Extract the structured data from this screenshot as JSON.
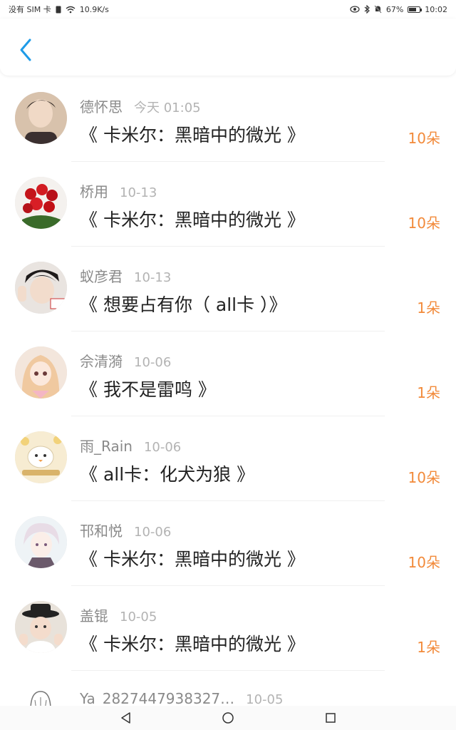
{
  "status": {
    "carrier": "没有 SIM 卡",
    "speed": "10.9K/s",
    "battery_percent": "67%",
    "time": "10:02"
  },
  "header": {
    "back_icon": "chevron-left-icon",
    "accent": "#1e9be8"
  },
  "items": [
    {
      "name": "德怀思",
      "time": "今天 01:05",
      "title": "《 卡米尔：黑暗中的微光 》",
      "count": "10朵",
      "avatar": "boy-portrait"
    },
    {
      "name": "桥用",
      "time": "10-13",
      "title": "《 卡米尔：黑暗中的微光 》",
      "count": "10朵",
      "avatar": "red-roses"
    },
    {
      "name": "蚁彦君",
      "time": "10-13",
      "title": "《 想要占有你（ all卡 ）》",
      "count": "1朵",
      "avatar": "boy-peace-sign"
    },
    {
      "name": "佘清漪",
      "time": "10-06",
      "title": "《 我不是雷鸣 》",
      "count": "1朵",
      "avatar": "anime-girl"
    },
    {
      "name": "雨_Rain",
      "time": "10-06",
      "title": "《 all卡：化犬为狼 》",
      "count": "10朵",
      "avatar": "cartoon-bird"
    },
    {
      "name": "邗和悦",
      "time": "10-06",
      "title": "《 卡米尔：黑暗中的微光 》",
      "count": "10朵",
      "avatar": "anime-boy"
    },
    {
      "name": "盖锟",
      "time": "10-05",
      "title": "《 卡米尔：黑暗中的微光 》",
      "count": "1朵",
      "avatar": "girl-hat"
    }
  ],
  "partial_item": {
    "name": "Ya",
    "id": "2827447938327…",
    "time": "10-05"
  },
  "colors": {
    "count": "#f28a3a",
    "name": "#8a8a8a",
    "time": "#b3b3b3"
  }
}
